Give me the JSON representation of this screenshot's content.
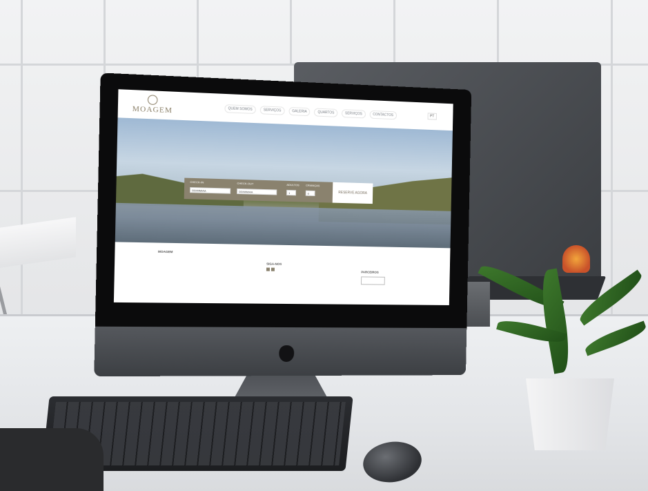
{
  "site": {
    "logo_text": "MOAGEM",
    "nav": [
      "QUEM SOMOS",
      "SERVIÇOS",
      "GALERIA",
      "QUARTOS",
      "SERVIÇOS",
      "CONTACTOS"
    ],
    "language": "PT",
    "booking": {
      "checkin_label": "CHECK-IN",
      "checkout_label": "CHECK-OUT",
      "adults_label": "ADULTOS",
      "children_label": "CRIANÇAS",
      "checkin_value": "DD/MM/AA",
      "checkout_value": "DD/MM/AA",
      "adults_value": "1",
      "children_value": "0",
      "button_label": "RESERVE AGORA"
    },
    "footer": {
      "col1_title": "MOAGEM",
      "social_title": "SIGA-NOS",
      "partners_title": "PARCEIROS"
    }
  }
}
